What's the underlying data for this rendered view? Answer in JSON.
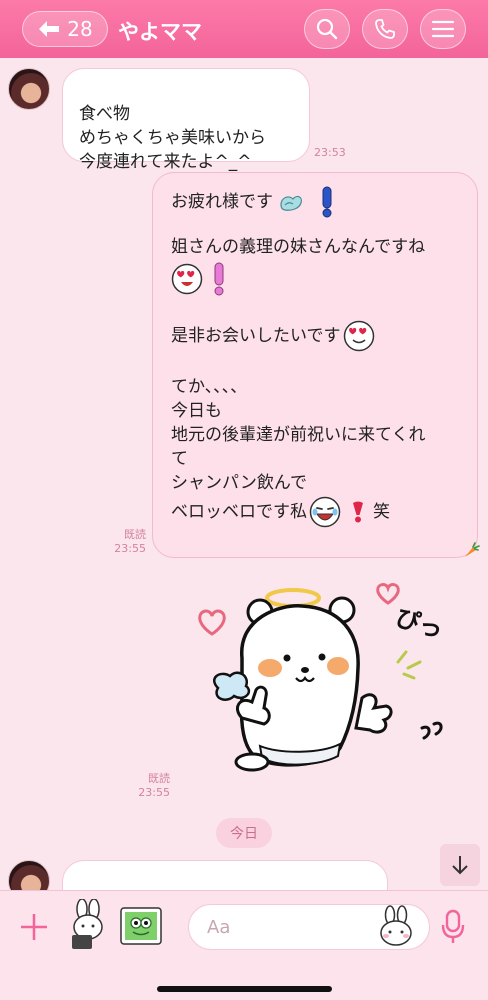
{
  "header": {
    "back_count": "28",
    "title": "やよママ",
    "icons": [
      "search-icon",
      "phone-icon",
      "menu-icon"
    ]
  },
  "messages": {
    "incoming_1": {
      "text": "食べ物\nめちゃくちゃ美味いから\n今度連れて来たよ^_^",
      "time": "23:53"
    },
    "outgoing_1": {
      "lines": {
        "l1": "お疲れ様です",
        "l2": "姐さんの義理の妹さんなんですね",
        "l3": "是非お会いしたいです",
        "l4": "てか、、、、",
        "l5": "今日も",
        "l6": "地元の後輩達が前祝いに来てくれ",
        "l7": "て",
        "l8": "シャンパン飲んで",
        "l9": "ベロッベロです私",
        "l9_end": "笑"
      },
      "read": "既読",
      "time": "23:55"
    },
    "sticker_1": {
      "text": "ぴっ",
      "read": "既読",
      "time": "23:55"
    }
  },
  "date_divider": "今日",
  "footer": {
    "input_placeholder": "Aa",
    "icons": [
      "plus-icon",
      "sticker-rabbit-icon",
      "photo-frog-icon",
      "emoji-rabbit-icon",
      "mic-icon"
    ]
  },
  "colors": {
    "accent": "#f3649a",
    "background": "#fbe6ee",
    "bubble_out": "#fde0ea",
    "timestamp": "#d4829f"
  }
}
